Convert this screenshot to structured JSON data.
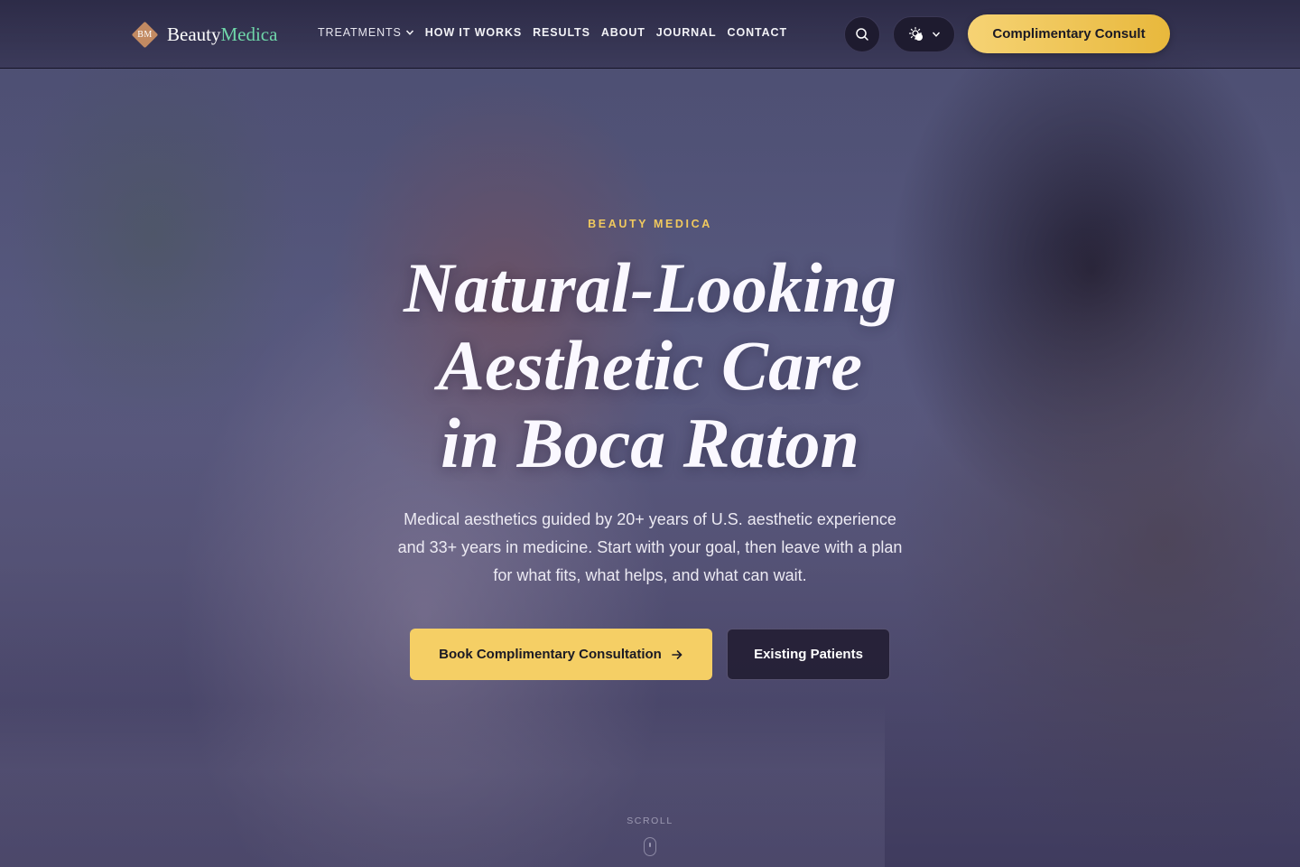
{
  "brand": {
    "monogram": "BM",
    "name_part1": "Beauty",
    "name_part2": "Medica"
  },
  "nav": {
    "items": [
      {
        "label": "TREATMENTS",
        "has_dropdown": true
      },
      {
        "label": "HOW IT WORKS"
      },
      {
        "label": "RESULTS"
      },
      {
        "label": "ABOUT"
      },
      {
        "label": "JOURNAL"
      },
      {
        "label": "CONTACT"
      }
    ]
  },
  "header_actions": {
    "search_icon": "search-icon",
    "theme_icon": "sun-icon",
    "consult_label": "Complimentary Consult"
  },
  "hero": {
    "eyebrow": "BEAUTY MEDICA",
    "headline_line1": "Natural-Looking",
    "headline_line2": "Aesthetic Care",
    "headline_line3": "in Boca Raton",
    "subcopy": "Medical aesthetics guided by 20+ years of U.S. aesthetic experience and 33+ years in medicine. Start with your goal, then leave with a plan for what fits, what helps, and what can wait.",
    "cta_primary": "Book Complimentary Consultation",
    "cta_secondary": "Existing Patients",
    "scroll_label": "SCROLL"
  },
  "colors": {
    "accent_gold": "#f5cf65",
    "brand_green": "#6fd6a9",
    "logo_copper": "#c28a62",
    "eyebrow_gold": "#f0c95e"
  }
}
